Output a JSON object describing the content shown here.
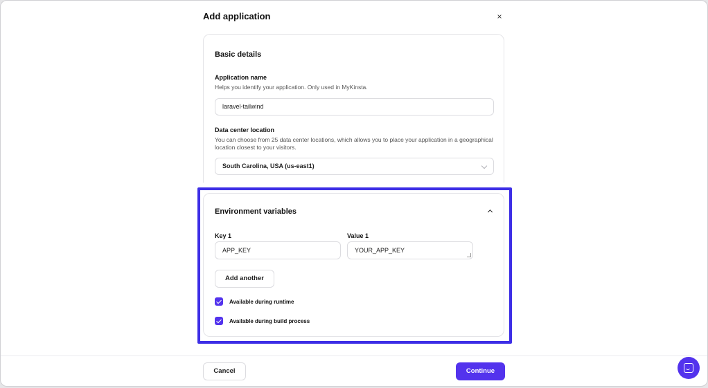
{
  "modal": {
    "title": "Add application",
    "close_symbol": "×"
  },
  "basic_details": {
    "title": "Basic details",
    "app_name": {
      "label": "Application name",
      "help": "Helps you identify your application. Only used in MyKinsta.",
      "value": "laravel-tailwind"
    },
    "data_center": {
      "label": "Data center location",
      "help": "You can choose from 25 data center locations, which allows you to place your application in a geographical location closest to your visitors.",
      "selected": "South Carolina, USA (us-east1)"
    }
  },
  "environment_variables": {
    "title": "Environment variables",
    "expanded": true,
    "rows": [
      {
        "key_label": "Key 1",
        "key_value": "APP_KEY",
        "value_label": "Value 1",
        "value_value": "YOUR_APP_KEY"
      }
    ],
    "add_another_label": "Add another",
    "checkboxes": [
      {
        "label": "Available during runtime",
        "checked": true
      },
      {
        "label": "Available during build process",
        "checked": true
      }
    ]
  },
  "footer": {
    "cancel_label": "Cancel",
    "continue_label": "Continue"
  },
  "colors": {
    "accent": "#5333ed",
    "highlight": "#3d2ee6"
  },
  "icons": {
    "close": "close-icon",
    "collapse": "chevron-up-icon",
    "select": "chevron-down-icon",
    "checkbox": "checkmark-icon",
    "chat": "chat-icon"
  }
}
